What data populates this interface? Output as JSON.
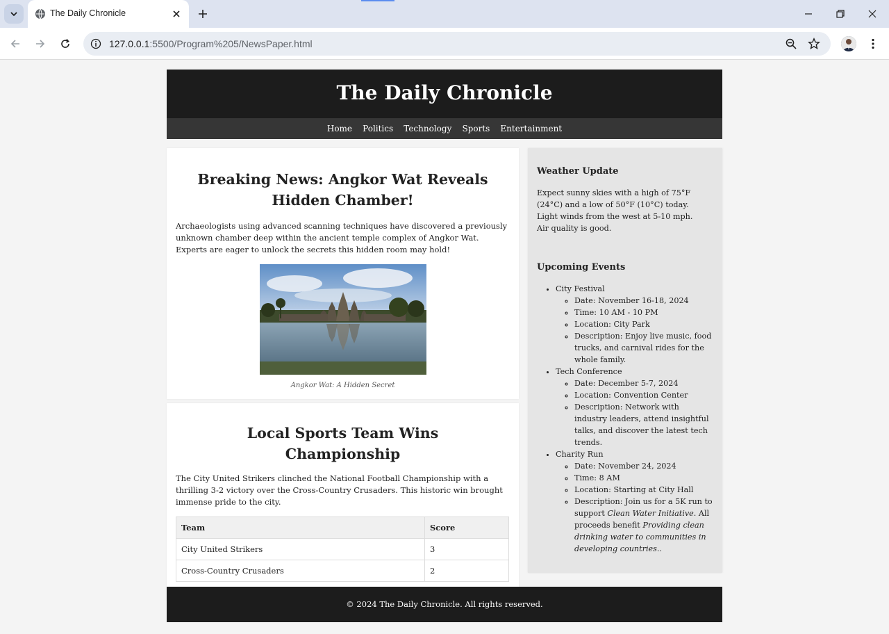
{
  "browser": {
    "tab_title": "The Daily Chronicle",
    "url_host": "127.0.0.1",
    "url_rest": ":5500/Program%205/NewsPaper.html"
  },
  "site": {
    "title": "The Daily Chronicle",
    "nav": [
      "Home",
      "Politics",
      "Technology",
      "Sports",
      "Entertainment"
    ]
  },
  "articles": {
    "angkor": {
      "headline": "Breaking News: Angkor Wat Reveals Hidden Chamber!",
      "body": "Archaeologists using advanced scanning techniques have discovered a previously unknown chamber deep within the ancient temple complex of Angkor Wat. Experts are eager to unlock the secrets this hidden room may hold!",
      "caption": "Angkor Wat: A Hidden Secret"
    },
    "sports": {
      "headline": "Local Sports Team Wins Championship",
      "body": "The City United Strikers clinched the National Football Championship with a thrilling 3-2 victory over the Cross-Country Crusaders. This historic win brought immense pride to the city.",
      "table_headers": [
        "Team",
        "Score"
      ],
      "rows": [
        [
          "City United Strikers",
          "3"
        ],
        [
          "Cross-Country Crusaders",
          "2"
        ]
      ]
    }
  },
  "sidebar": {
    "weather": {
      "title": "Weather Update",
      "line1": "Expect sunny skies with a high of 75°F (24°C) and a low of 50°F (10°C) today.",
      "line2": "Light winds from the west at 5-10 mph.",
      "line3": "Air quality is good."
    },
    "events": {
      "title": "Upcoming Events",
      "festival": {
        "name": "City Festival",
        "date": "Date: November 16-18, 2024",
        "time": "Time: 10 AM - 10 PM",
        "location": "Location: City Park",
        "description": "Description: Enjoy live music, food trucks, and carnival rides for the whole family."
      },
      "conference": {
        "name": "Tech Conference",
        "date": "Date: December 5-7, 2024",
        "location": "Location: Convention Center",
        "description": "Description: Network with industry leaders, attend insightful talks, and discover the latest tech trends."
      },
      "run": {
        "name": "Charity Run",
        "date": "Date: November 24, 2024",
        "time": "Time: 8 AM",
        "location": "Location: Starting at City Hall",
        "desc_prefix": "Description: Join us for a 5K run to support ",
        "desc_em1": "Clean Water Initiative",
        "desc_mid": ". All proceeds benefit ",
        "desc_em2": "Providing clean drinking water to communities in developing countries.",
        "desc_suffix": "."
      }
    }
  },
  "footer": "© 2024 The Daily Chronicle. All rights reserved."
}
